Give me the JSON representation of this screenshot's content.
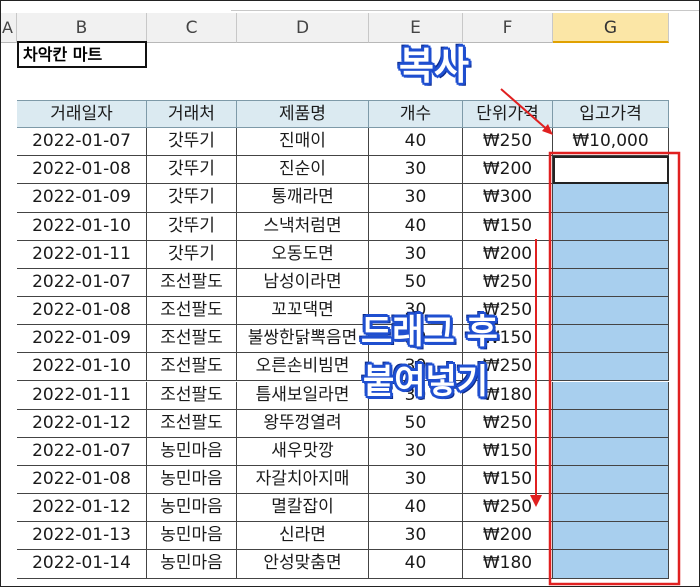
{
  "column_headers": [
    "A",
    "B",
    "C",
    "D",
    "E",
    "F",
    "G"
  ],
  "active_column": "G",
  "title_cell": "차악칸 마트",
  "table": {
    "headers": [
      "거래일자",
      "거래처",
      "제품명",
      "개수",
      "단위가격",
      "입고가격"
    ],
    "rows": [
      [
        "2022-01-07",
        "갓뚜기",
        "진매이",
        "40",
        "₩250",
        "₩10,000"
      ],
      [
        "2022-01-08",
        "갓뚜기",
        "진순이",
        "30",
        "₩200",
        ""
      ],
      [
        "2022-01-09",
        "갓뚜기",
        "통깨라면",
        "30",
        "₩300",
        ""
      ],
      [
        "2022-01-10",
        "갓뚜기",
        "스낵처럼면",
        "40",
        "₩150",
        ""
      ],
      [
        "2022-01-11",
        "갓뚜기",
        "오동도면",
        "30",
        "₩200",
        ""
      ],
      [
        "2022-01-07",
        "조선팔도",
        "남성이라면",
        "50",
        "₩250",
        ""
      ],
      [
        "2022-01-08",
        "조선팔도",
        "꼬꼬댁면",
        "30",
        "₩250",
        ""
      ],
      [
        "2022-01-09",
        "조선팔도",
        "불쌍한닭뽁음면",
        "30",
        "₩150",
        ""
      ],
      [
        "2022-01-10",
        "조선팔도",
        "오른손비빔면",
        "30",
        "₩250",
        ""
      ],
      [
        "2022-01-11",
        "조선팔도",
        "틈새보일라면",
        "30",
        "₩180",
        ""
      ],
      [
        "2022-01-12",
        "조선팔도",
        "왕뚜껑열려",
        "50",
        "₩250",
        ""
      ],
      [
        "2022-01-07",
        "농민마음",
        "새우맛깡",
        "30",
        "₩150",
        ""
      ],
      [
        "2022-01-08",
        "농민마음",
        "자갈치아지매",
        "30",
        "₩150",
        ""
      ],
      [
        "2022-01-12",
        "농민마음",
        "멸칼잡이",
        "40",
        "₩250",
        ""
      ],
      [
        "2022-01-13",
        "농민마음",
        "신라면",
        "30",
        "₩200",
        ""
      ],
      [
        "2022-01-14",
        "농민마음",
        "안성맞춤면",
        "40",
        "₩180",
        ""
      ]
    ]
  },
  "annotations": {
    "copy": "복사",
    "paste_line1": "드래그 후",
    "paste_line2": "붙여넣기"
  },
  "colors": {
    "header_fill": "#dbeaf1",
    "selection_fill": "#a8cfee",
    "annotation_red": "#e02020",
    "annotation_blue": "#1f4fd0"
  }
}
